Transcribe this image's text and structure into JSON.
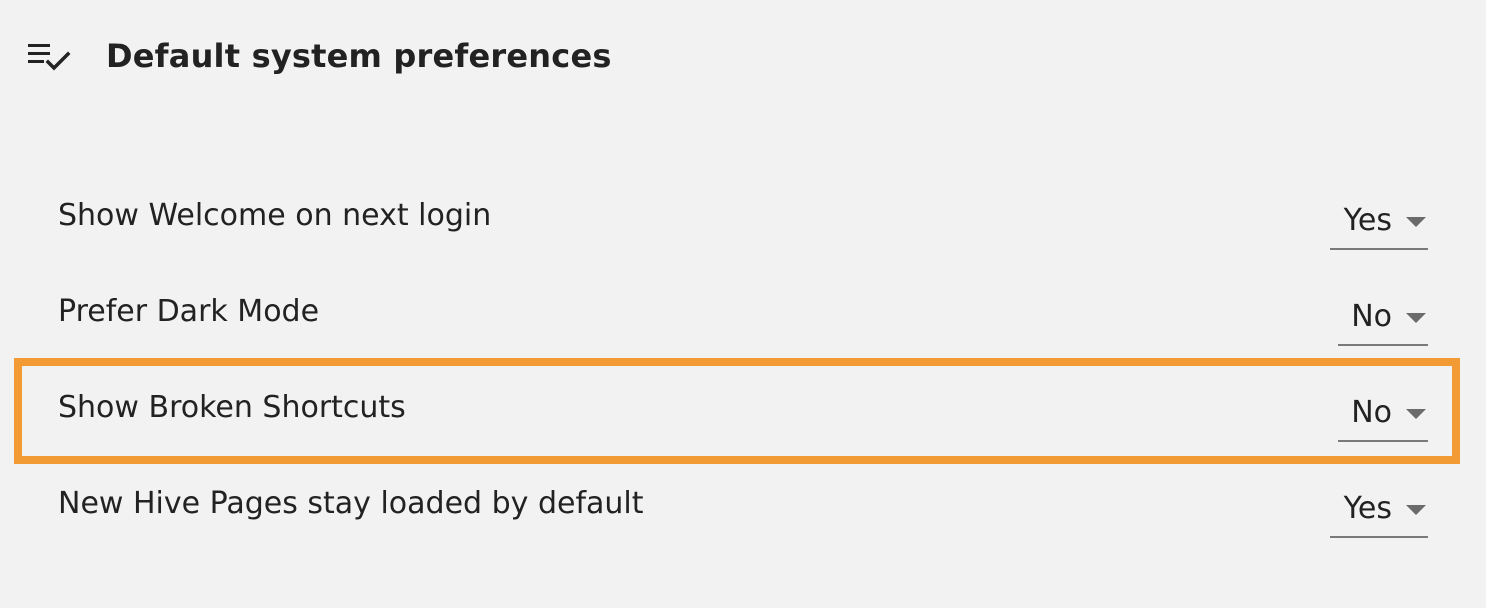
{
  "header": {
    "title": "Default system preferences",
    "icon": "checklist-icon"
  },
  "preferences": [
    {
      "label": "Show Welcome on next login",
      "value": "Yes"
    },
    {
      "label": "Prefer Dark Mode",
      "value": "No"
    },
    {
      "label": "Show Broken Shortcuts",
      "value": "No"
    },
    {
      "label": "New Hive Pages stay loaded by default",
      "value": "Yes"
    }
  ],
  "highlight": {
    "target": "Show Broken Shortcuts",
    "color": "#f29a34"
  }
}
